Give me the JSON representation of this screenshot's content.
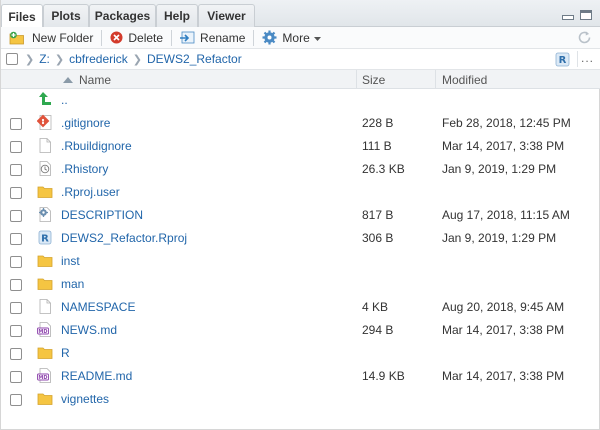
{
  "tabs": [
    {
      "label": "Files",
      "active": true
    },
    {
      "label": "Plots",
      "active": false
    },
    {
      "label": "Packages",
      "active": false
    },
    {
      "label": "Help",
      "active": false
    },
    {
      "label": "Viewer",
      "active": false
    }
  ],
  "toolbar": {
    "new_folder": "New Folder",
    "delete": "Delete",
    "rename": "Rename",
    "more": "More"
  },
  "breadcrumb": [
    "Z:",
    "cbfrederick",
    "DEWS2_Refactor"
  ],
  "breadcrumb_more": "...",
  "columns": {
    "name": "Name",
    "size": "Size",
    "modified": "Modified"
  },
  "files": [
    {
      "icon": "parent-dir-icon",
      "name": "..",
      "size": "",
      "modified": ""
    },
    {
      "icon": "git-icon",
      "name": ".gitignore",
      "size": "228 B",
      "modified": "Feb 28, 2018, 12:45 PM"
    },
    {
      "icon": "file-icon",
      "name": ".Rbuildignore",
      "size": "111 B",
      "modified": "Mar 14, 2017, 3:38 PM"
    },
    {
      "icon": "history-icon",
      "name": ".Rhistory",
      "size": "26.3 KB",
      "modified": "Jan 9, 2019, 1:29 PM"
    },
    {
      "icon": "folder-icon",
      "name": ".Rproj.user",
      "size": "",
      "modified": ""
    },
    {
      "icon": "description-gear-icon",
      "name": "DESCRIPTION",
      "size": "817 B",
      "modified": "Aug 17, 2018, 11:15 AM"
    },
    {
      "icon": "rproj-icon",
      "name": "DEWS2_Refactor.Rproj",
      "size": "306 B",
      "modified": "Jan 9, 2019, 1:29 PM"
    },
    {
      "icon": "folder-icon",
      "name": "inst",
      "size": "",
      "modified": ""
    },
    {
      "icon": "folder-icon",
      "name": "man",
      "size": "",
      "modified": ""
    },
    {
      "icon": "file-icon",
      "name": "NAMESPACE",
      "size": "4 KB",
      "modified": "Aug 20, 2018, 9:45 AM"
    },
    {
      "icon": "markdown-icon",
      "name": "NEWS.md",
      "size": "294 B",
      "modified": "Mar 14, 2017, 3:38 PM"
    },
    {
      "icon": "folder-icon",
      "name": "R",
      "size": "",
      "modified": ""
    },
    {
      "icon": "markdown-icon",
      "name": "README.md",
      "size": "14.9 KB",
      "modified": "Mar 14, 2017, 3:38 PM"
    },
    {
      "icon": "folder-icon",
      "name": "vignettes",
      "size": "",
      "modified": ""
    }
  ],
  "colors": {
    "link": "#2266aa",
    "folder": "#f5c542",
    "markdown": "#8e44ad",
    "git": "#e0533c"
  }
}
